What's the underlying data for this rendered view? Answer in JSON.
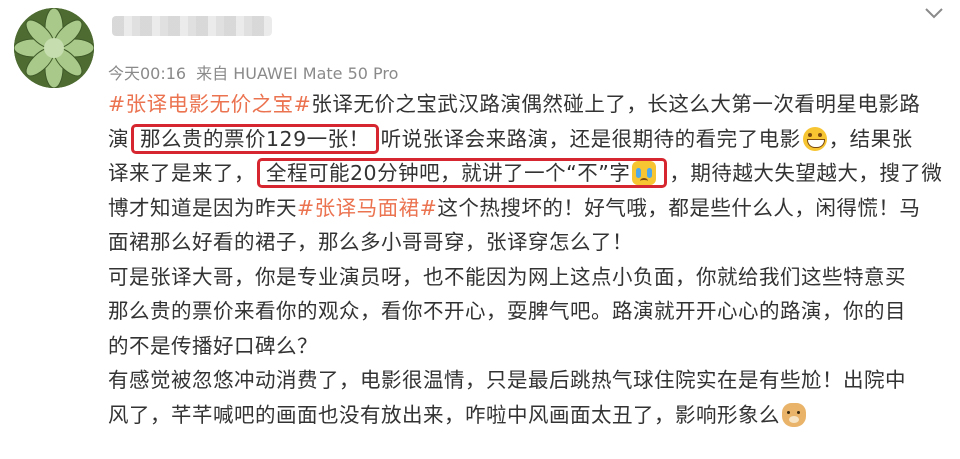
{
  "post": {
    "author": {
      "avatar_icon": "succulent-avatar-icon"
    },
    "meta": {
      "time": "今天00:16",
      "source": "来自 HUAWEI Mate 50 Pro"
    },
    "menu_icon": "chevron-down-icon",
    "colors": {
      "tag": "#eb7350",
      "highlight_box": "#d6262f",
      "meta": "#8a8a8a",
      "text": "#333333"
    },
    "body": {
      "l1_tag": "#张译电影无价之宝#",
      "l1_text": "张译无价之宝武汉路演偶然碰上了，长这么大第一次看明星电影路",
      "l2_a": "演",
      "l2_box": "那么贵的票价129一张！",
      "l2_b": "听说张译会来路演，还是很期待的看完了电影",
      "l2_emoji": "grin-emoji-icon",
      "l2_c": "，结果张",
      "l3_a": "译来了是来了，",
      "l3_box": "全程可能20分钟吧，就讲了一个“不”字",
      "l3_emoji": "crying-emoji-icon",
      "l3_b": "，期待越大失望越大，搜了微",
      "l4_a": "博才知道是因为昨天",
      "l4_tag": "#张译马面裙#",
      "l4_b": "这个热搜坏的！好气哦，都是些什么人，闲得慌！马",
      "l5": "面裙那么好看的裙子，那么多小哥哥穿，张译穿怎么了！",
      "l6": "可是张译大哥，你是专业演员呀，也不能因为网上这点小负面，你就给我们这些特意买",
      "l7": "那么贵的票价来看你的观众，看你不开心，耍脾气吧。路演就开开心心的路演，你的目",
      "l8": "的不是传播好口碑么？",
      "l9": "有感觉被忽悠冲动消费了，电影很温情，只是最后跳热气球住院实在是有些尬！出院中",
      "l10": "风了，芊芊喊吧的画面也没有放出来，咋啦中风画面太丑了，影响形象么",
      "l10_emoji": "doge-emoji-icon"
    }
  }
}
